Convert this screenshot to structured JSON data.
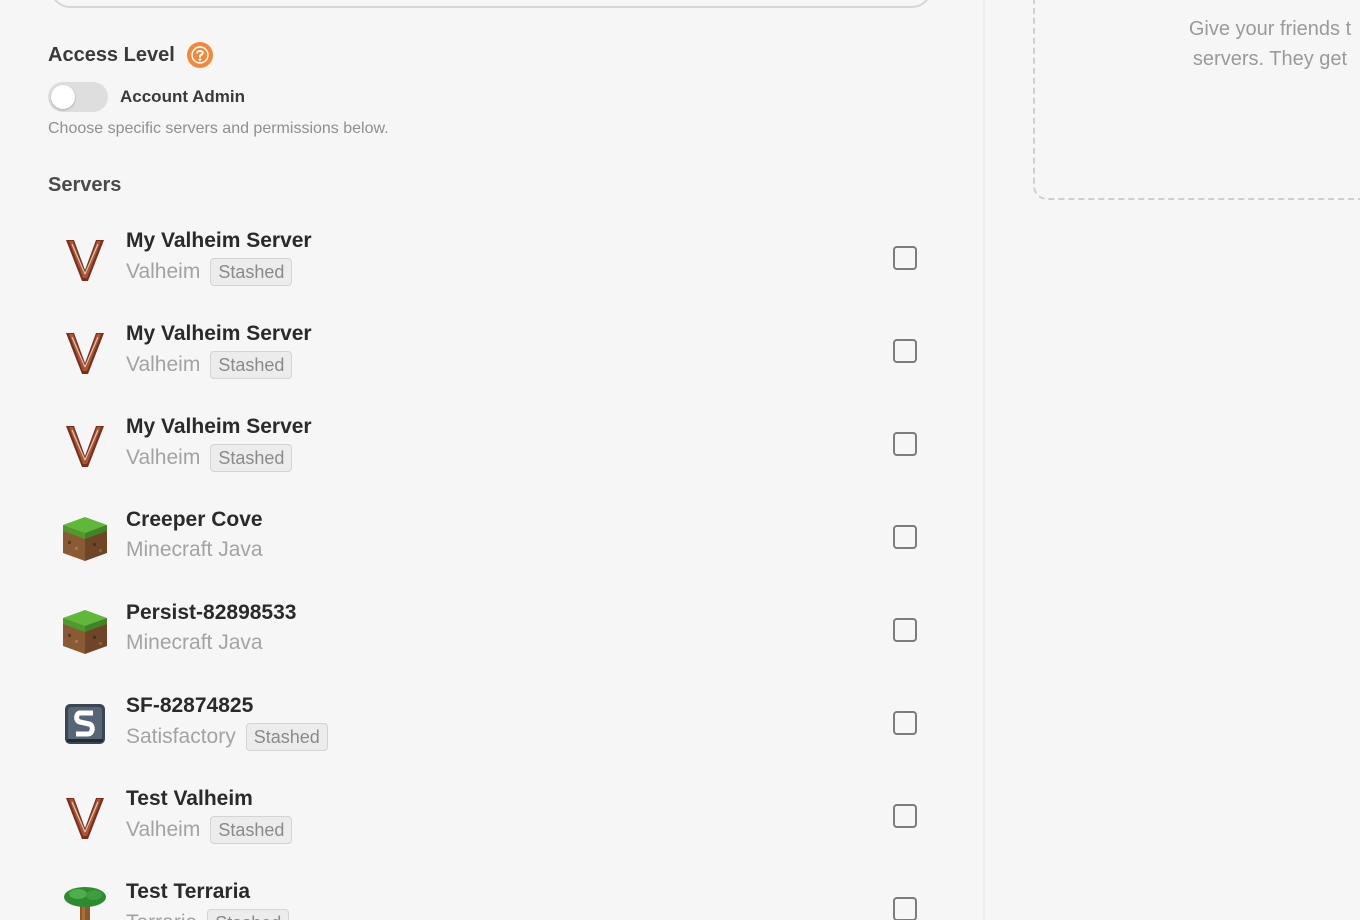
{
  "access": {
    "title": "Access Level",
    "help_icon": "question-icon",
    "toggle_label": "Account Admin",
    "toggle_on": false,
    "helper_text": "Choose specific servers and permissions below."
  },
  "servers": {
    "title": "Servers",
    "items": [
      {
        "name": "My Valheim Server",
        "game": "Valheim",
        "badge": "Stashed",
        "icon": "valheim-icon",
        "checked": false
      },
      {
        "name": "My Valheim Server",
        "game": "Valheim",
        "badge": "Stashed",
        "icon": "valheim-icon",
        "checked": false
      },
      {
        "name": "My Valheim Server",
        "game": "Valheim",
        "badge": "Stashed",
        "icon": "valheim-icon",
        "checked": false
      },
      {
        "name": "Creeper Cove",
        "game": "Minecraft Java",
        "badge": "",
        "icon": "minecraft-icon",
        "checked": false
      },
      {
        "name": "Persist-82898533",
        "game": "Minecraft Java",
        "badge": "",
        "icon": "minecraft-icon",
        "checked": false
      },
      {
        "name": "SF-82874825",
        "game": "Satisfactory",
        "badge": "Stashed",
        "icon": "satisfactory-icon",
        "checked": false
      },
      {
        "name": "Test Valheim",
        "game": "Valheim",
        "badge": "Stashed",
        "icon": "valheim-icon",
        "checked": false
      },
      {
        "name": "Test Terraria",
        "game": "Terraria",
        "badge": "Stashed",
        "icon": "terraria-icon",
        "checked": false
      }
    ]
  },
  "invite": {
    "line1": "Give your friends t",
    "line2": "servers. They get"
  },
  "colors": {
    "background": "#f6f6f6",
    "help_icon": "#f0893c",
    "toggle_off": "#dedede"
  }
}
